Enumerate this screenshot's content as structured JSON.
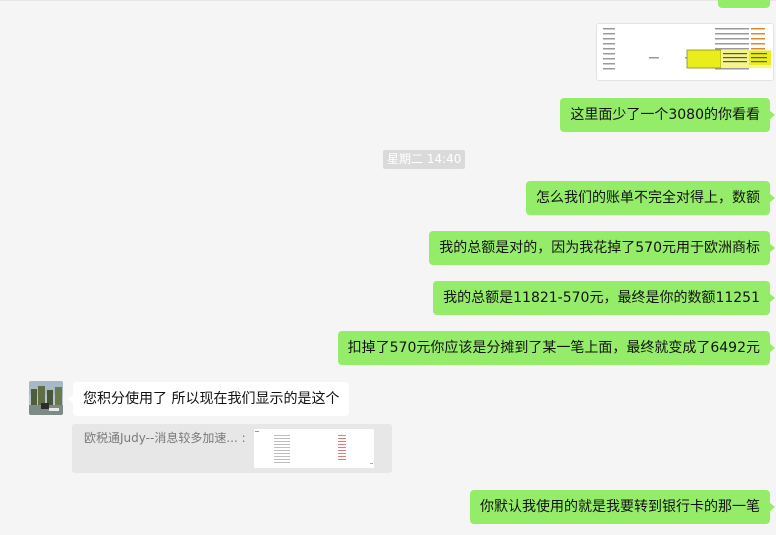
{
  "date_separator": "星期二 14:40",
  "messages": {
    "m1": "这里面少了一个3080的你看看",
    "m2": "怎么我们的账单不完全对得上，数额",
    "m3": "我的总额是对的，因为我花掉了570元用于欧洲商标",
    "m4": "我的总额是11821-570元，最终是你的数额11251",
    "m5": "扣掉了570元你应该是分摊到了某一笔上面，最终就变成了6492元",
    "m6": "您积分使用了  所以现在我们显示的是这个",
    "m7": "你默认我使用的就是我要转到银行卡的那一笔"
  },
  "quote": {
    "text": "欧税通Judy--消息较多加速... :"
  },
  "colors": {
    "outgoing_bubble": "#95ec69",
    "incoming_bubble": "#ffffff",
    "background": "#f5f5f5",
    "time_tag": "#dadada"
  }
}
